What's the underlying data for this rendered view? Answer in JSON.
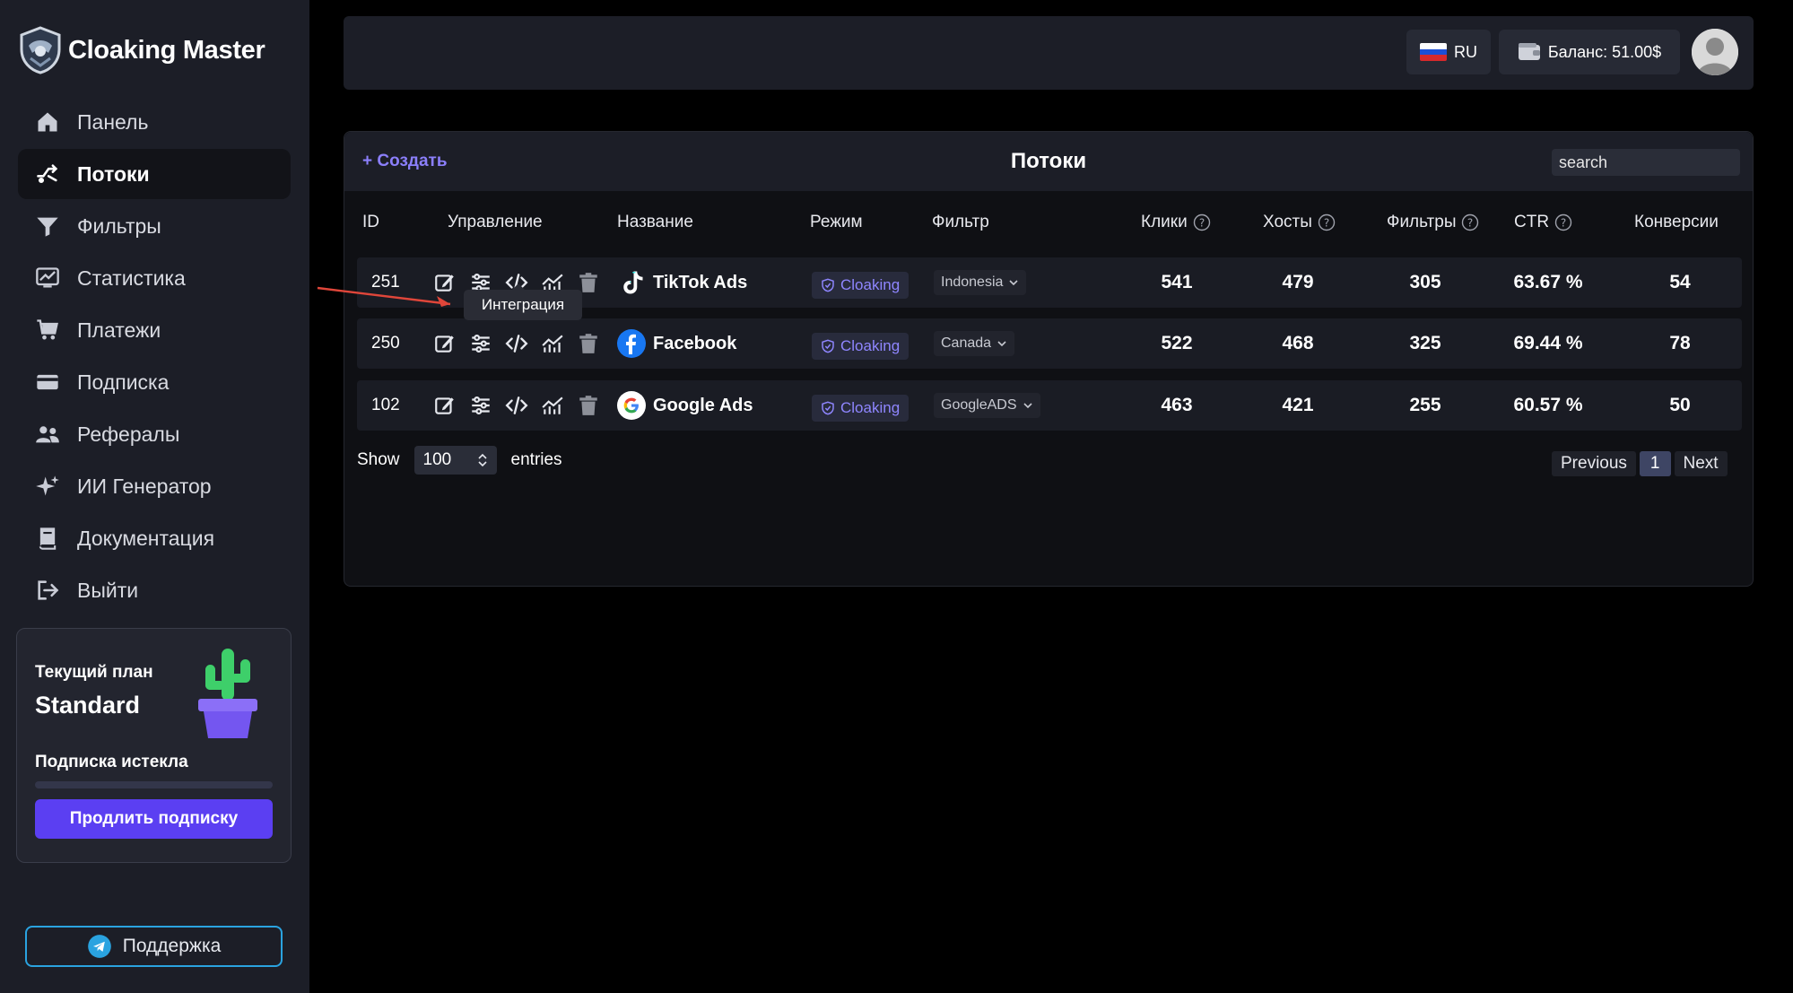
{
  "brand": {
    "name": "Cloaking Master"
  },
  "nav": {
    "items": [
      {
        "label": "Панель",
        "icon": "home-icon"
      },
      {
        "label": "Потоки",
        "icon": "streams-icon",
        "active": true
      },
      {
        "label": "Фильтры",
        "icon": "filter-icon"
      },
      {
        "label": "Статистика",
        "icon": "stats-icon"
      },
      {
        "label": "Платежи",
        "icon": "cart-icon"
      },
      {
        "label": "Подписка",
        "icon": "card-icon"
      },
      {
        "label": "Рефералы",
        "icon": "users-icon"
      },
      {
        "label": "ИИ Генератор",
        "icon": "sparkles-icon"
      },
      {
        "label": "Документация",
        "icon": "book-icon"
      },
      {
        "label": "Выйти",
        "icon": "logout-icon"
      }
    ]
  },
  "plan": {
    "caption": "Текущий план",
    "name": "Standard",
    "status": "Подписка истекла",
    "progress": 0,
    "renew_label": "Продлить подписку"
  },
  "support": {
    "label": "Поддержка"
  },
  "topbar": {
    "lang": "RU",
    "balance": "Баланс: 51.00$"
  },
  "streams": {
    "create_label": "+ Создать",
    "title": "Потоки",
    "search_placeholder": "search",
    "columns": {
      "id": "ID",
      "manage": "Управление",
      "name": "Название",
      "mode": "Режим",
      "filter": "Фильтр",
      "clicks": "Клики",
      "hosts": "Хосты",
      "filters": "Фильтры",
      "ctr": "CTR",
      "conversions": "Конверсии"
    },
    "rows": [
      {
        "id": "251",
        "name": "TikTok Ads",
        "platform": "tiktok-logo-icon",
        "mode": "Cloaking",
        "filter": "Indonesia",
        "clicks": "541",
        "hosts": "479",
        "filters": "305",
        "ctr": "63.67 %",
        "conversions": "54"
      },
      {
        "id": "250",
        "name": "Facebook",
        "platform": "facebook-logo-icon",
        "mode": "Cloaking",
        "filter": "Canada",
        "clicks": "522",
        "hosts": "468",
        "filters": "325",
        "ctr": "69.44 %",
        "conversions": "78"
      },
      {
        "id": "102",
        "name": "Google Ads",
        "platform": "google-logo-icon",
        "mode": "Cloaking",
        "filter": "GoogleADS",
        "clicks": "463",
        "hosts": "421",
        "filters": "255",
        "ctr": "60.57 %",
        "conversions": "50"
      }
    ],
    "tooltip": "Интеграция",
    "show_label": "Show",
    "entries_value": "100",
    "entries_label": "entries",
    "pager": {
      "previous": "Previous",
      "current": "1",
      "next": "Next"
    }
  },
  "colors": {
    "sidebar_bg": "#1c1e27",
    "accent": "#5b3ff2",
    "accent_text": "#8b7ffb",
    "support_border": "#2aa3e0",
    "annotation_arrow": "#e0463a"
  }
}
